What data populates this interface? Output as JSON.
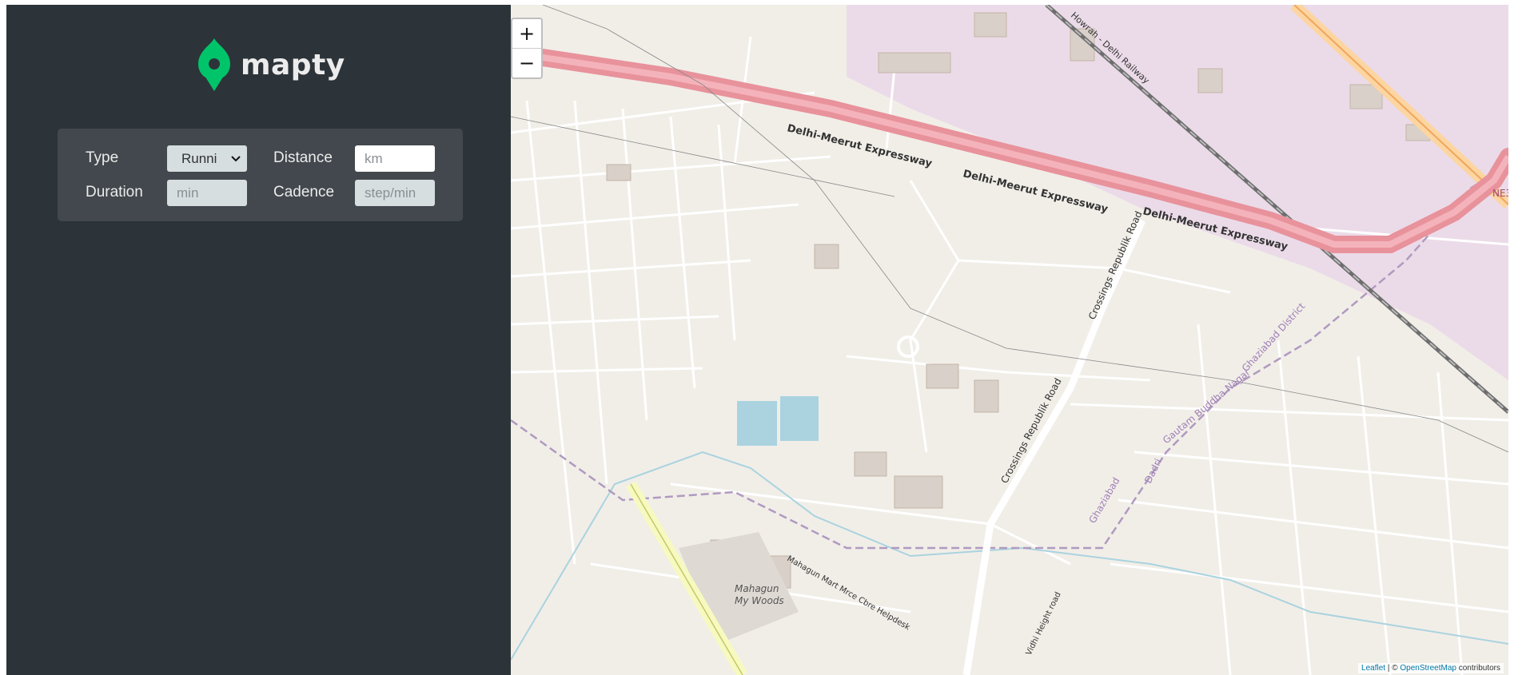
{
  "app": {
    "name": "mapty"
  },
  "form": {
    "type_label": "Type",
    "type_selected": "Runni",
    "distance_label": "Distance",
    "distance_placeholder": "km",
    "duration_label": "Duration",
    "duration_placeholder": "min",
    "cadence_label": "Cadence",
    "cadence_placeholder": "step/min"
  },
  "map": {
    "zoom_in": "+",
    "zoom_out": "−",
    "labels": {
      "expressway_1": "Delhi-Meerut Expressway",
      "expressway_2": "Delhi-Meerut Expressway",
      "expressway_3": "Delhi-Meerut Expressway",
      "railway": "Howrah - Delhi Railway",
      "road_1": "Crossings Republik Road",
      "road_2": "Crossings Republik Road",
      "district": "Ghaziabad District",
      "gautam": "Gautam Buddha Nagar",
      "dadri": "Dadri",
      "ghaziabad": "Ghaziabad",
      "mahagun_1": "Mahagun",
      "mahagun_2": "My Woods",
      "mahagun_mart": "Mahagun Mart Mrce Cbre Helpdesk",
      "vidhi": "Vidhi Height road",
      "ne3": "NE3"
    },
    "attribution": {
      "leaflet": "Leaflet",
      "separator": " | © ",
      "osm": "OpenStreetMap",
      "contributors": " contributors"
    }
  },
  "colors": {
    "sidebar_bg": "#2d3439",
    "form_bg": "#42484d",
    "brand_green": "#00c46a",
    "expressway": "#e8929c",
    "industrial": "#ebdbe8",
    "water": "#aad3df"
  }
}
